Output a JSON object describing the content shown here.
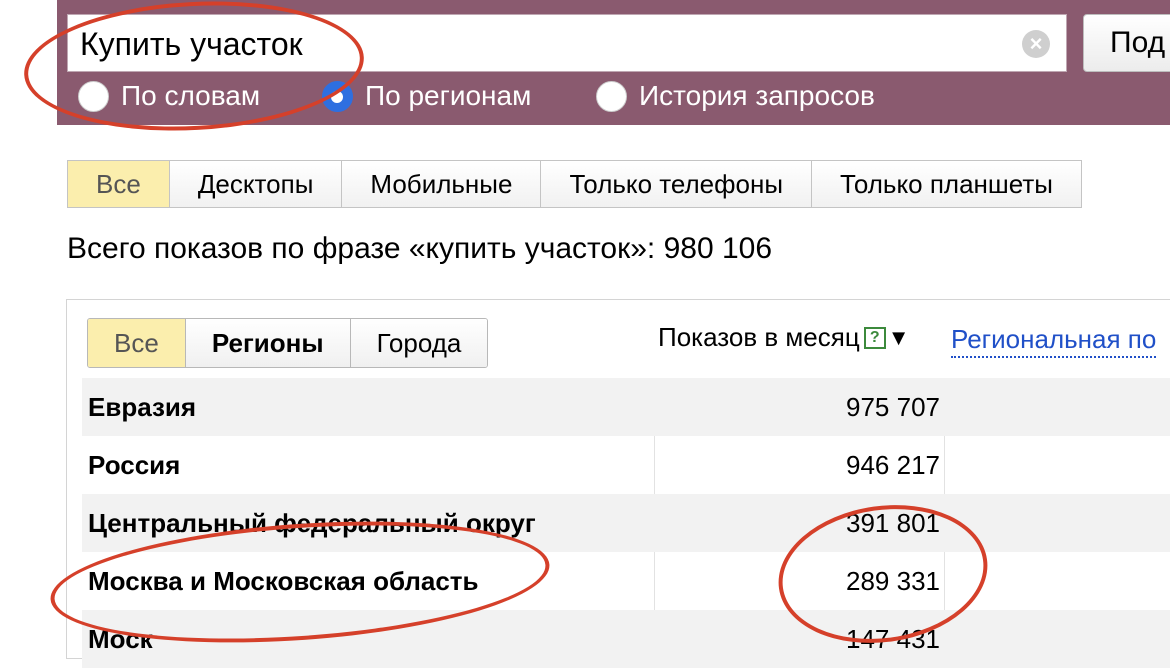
{
  "search": {
    "query": "Купить участок",
    "submit_label": "Под",
    "clear_icon": "clear-icon"
  },
  "search_modes": [
    {
      "label": "По словам",
      "checked": false
    },
    {
      "label": "По регионам",
      "checked": true
    },
    {
      "label": "История запросов",
      "checked": false
    }
  ],
  "device_tabs": [
    "Все",
    "Десктопы",
    "Мобильные",
    "Только телефоны",
    "Только планшеты"
  ],
  "total_line": "Всего показов по фразе «купить участок»: 980 106",
  "regions_panel": {
    "subtabs": [
      "Все",
      "Регионы",
      "Города"
    ],
    "column_header": "Показов в месяц",
    "help_icon": "help-icon",
    "sort_icon": "sort-desc-icon",
    "regional_link": "Региональная по",
    "rows": [
      {
        "name": "Евразия",
        "count": "975 707"
      },
      {
        "name": "Россия",
        "count": "946 217"
      },
      {
        "name": "Центральный федеральный округ",
        "count": "391 801"
      },
      {
        "name": "Москва и Московская область",
        "count": "289 331"
      },
      {
        "name": "Моск",
        "count": "147 431"
      }
    ]
  },
  "colors": {
    "topbar": "#8a5a6f",
    "active_tab": "#fbeead",
    "link": "#2050c8",
    "annotation": "#d5402a"
  }
}
